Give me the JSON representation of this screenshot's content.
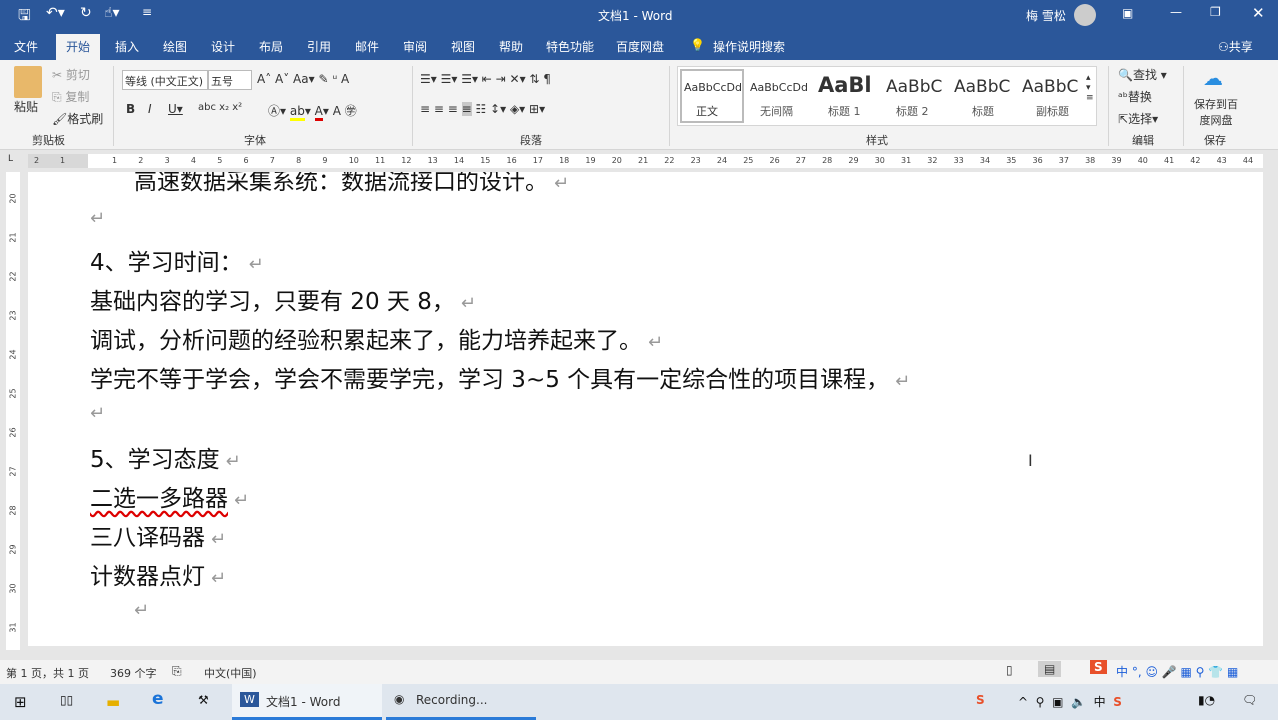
{
  "title": {
    "doc": "文档1 - Word",
    "user": "梅 雪松"
  },
  "tabs": [
    "文件",
    "开始",
    "插入",
    "绘图",
    "设计",
    "布局",
    "引用",
    "邮件",
    "审阅",
    "视图",
    "帮助",
    "特色功能",
    "百度网盘"
  ],
  "tell_me": "操作说明搜索",
  "share": "共享",
  "clipboard": {
    "paste": "粘贴",
    "cut": "剪切",
    "copy": "复制",
    "format_painter": "格式刷",
    "group": "剪贴板"
  },
  "font": {
    "name": "等线 (中文正文)",
    "size": "五号",
    "group": "字体"
  },
  "paragraph": {
    "group": "段落"
  },
  "styles": {
    "items": [
      {
        "preview": "AaBbCcDd",
        "label": "正文"
      },
      {
        "preview": "AaBbCcDd",
        "label": "无间隔"
      },
      {
        "preview": "AaBl",
        "label": "标题 1"
      },
      {
        "preview": "AaBbC",
        "label": "标题 2"
      },
      {
        "preview": "AaBbC",
        "label": "标题"
      },
      {
        "preview": "AaBbC",
        "label": "副标题"
      }
    ],
    "group": "样式"
  },
  "editing": {
    "find": "查找",
    "replace": "替换",
    "select": "选择",
    "group": "编辑"
  },
  "save": {
    "label": "保存到百度网盘",
    "group": "保存"
  },
  "ruler": {
    "left": [
      "2",
      "1"
    ],
    "right": [
      "1",
      "2",
      "3",
      "4",
      "5",
      "6",
      "7",
      "8",
      "9",
      "10",
      "11",
      "12",
      "13",
      "14",
      "15",
      "16",
      "17",
      "18",
      "19",
      "20",
      "21",
      "22",
      "23",
      "24",
      "25",
      "26",
      "27",
      "28",
      "29",
      "30",
      "31",
      "32",
      "33",
      "34",
      "35",
      "36",
      "37",
      "38",
      "39",
      "40",
      "41",
      "42",
      "43",
      "44"
    ]
  },
  "vruler": [
    "20",
    "21",
    "22",
    "23",
    "24",
    "25",
    "26",
    "27",
    "28",
    "29",
    "30",
    "31"
  ],
  "document": {
    "lines": [
      "高速数据采集系统：数据流接口的设计。",
      "",
      "4、学习时间：",
      "基础内容的学习，只要有 20 天 8，",
      "调试，分析问题的经验积累起来了，能力培养起来了。",
      "学完不等于学会，学会不需要学完，学习 3~5 个具有一定综合性的项目课程，",
      "",
      "5、学习态度",
      "二选一多路器",
      "三八译码器",
      "计数器点灯",
      ""
    ]
  },
  "status": {
    "page": "第 1 页，共 1 页",
    "words": "369 个字",
    "lang": "中文(中国)"
  },
  "taskbar": {
    "word": "文档1 - Word",
    "recording": "Recording..."
  },
  "colors": {
    "accent": "#2b579a"
  }
}
